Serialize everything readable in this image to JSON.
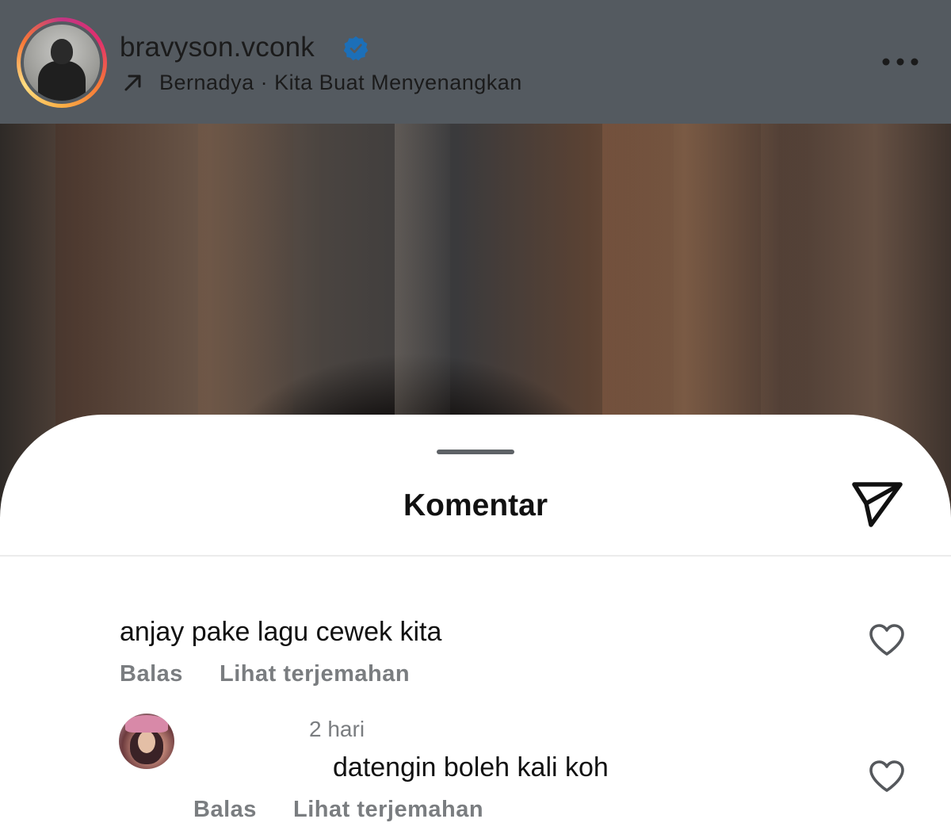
{
  "post": {
    "username": "bravyson.vconk",
    "song": "Bernadya · Kita Buat Menyenangkan"
  },
  "sheet": {
    "title": "Komentar"
  },
  "comments": [
    {
      "text": "anjay pake lagu cewek kita",
      "reply_label": "Balas",
      "translate_label": "Lihat terjemahan"
    },
    {
      "time": "2 hari",
      "text": "datengin boleh kali koh",
      "reply_label": "Balas",
      "translate_label": "Lihat terjemahan"
    }
  ],
  "colors": {
    "verified": "#1c6fb8",
    "header_overlay": "#545a60",
    "meta_text": "#7a7d80"
  },
  "icons": {
    "verified": "verified-badge-icon",
    "song": "arrow-up-right-icon",
    "more": "more-horizontal-icon",
    "share": "send-icon",
    "like": "heart-icon"
  }
}
